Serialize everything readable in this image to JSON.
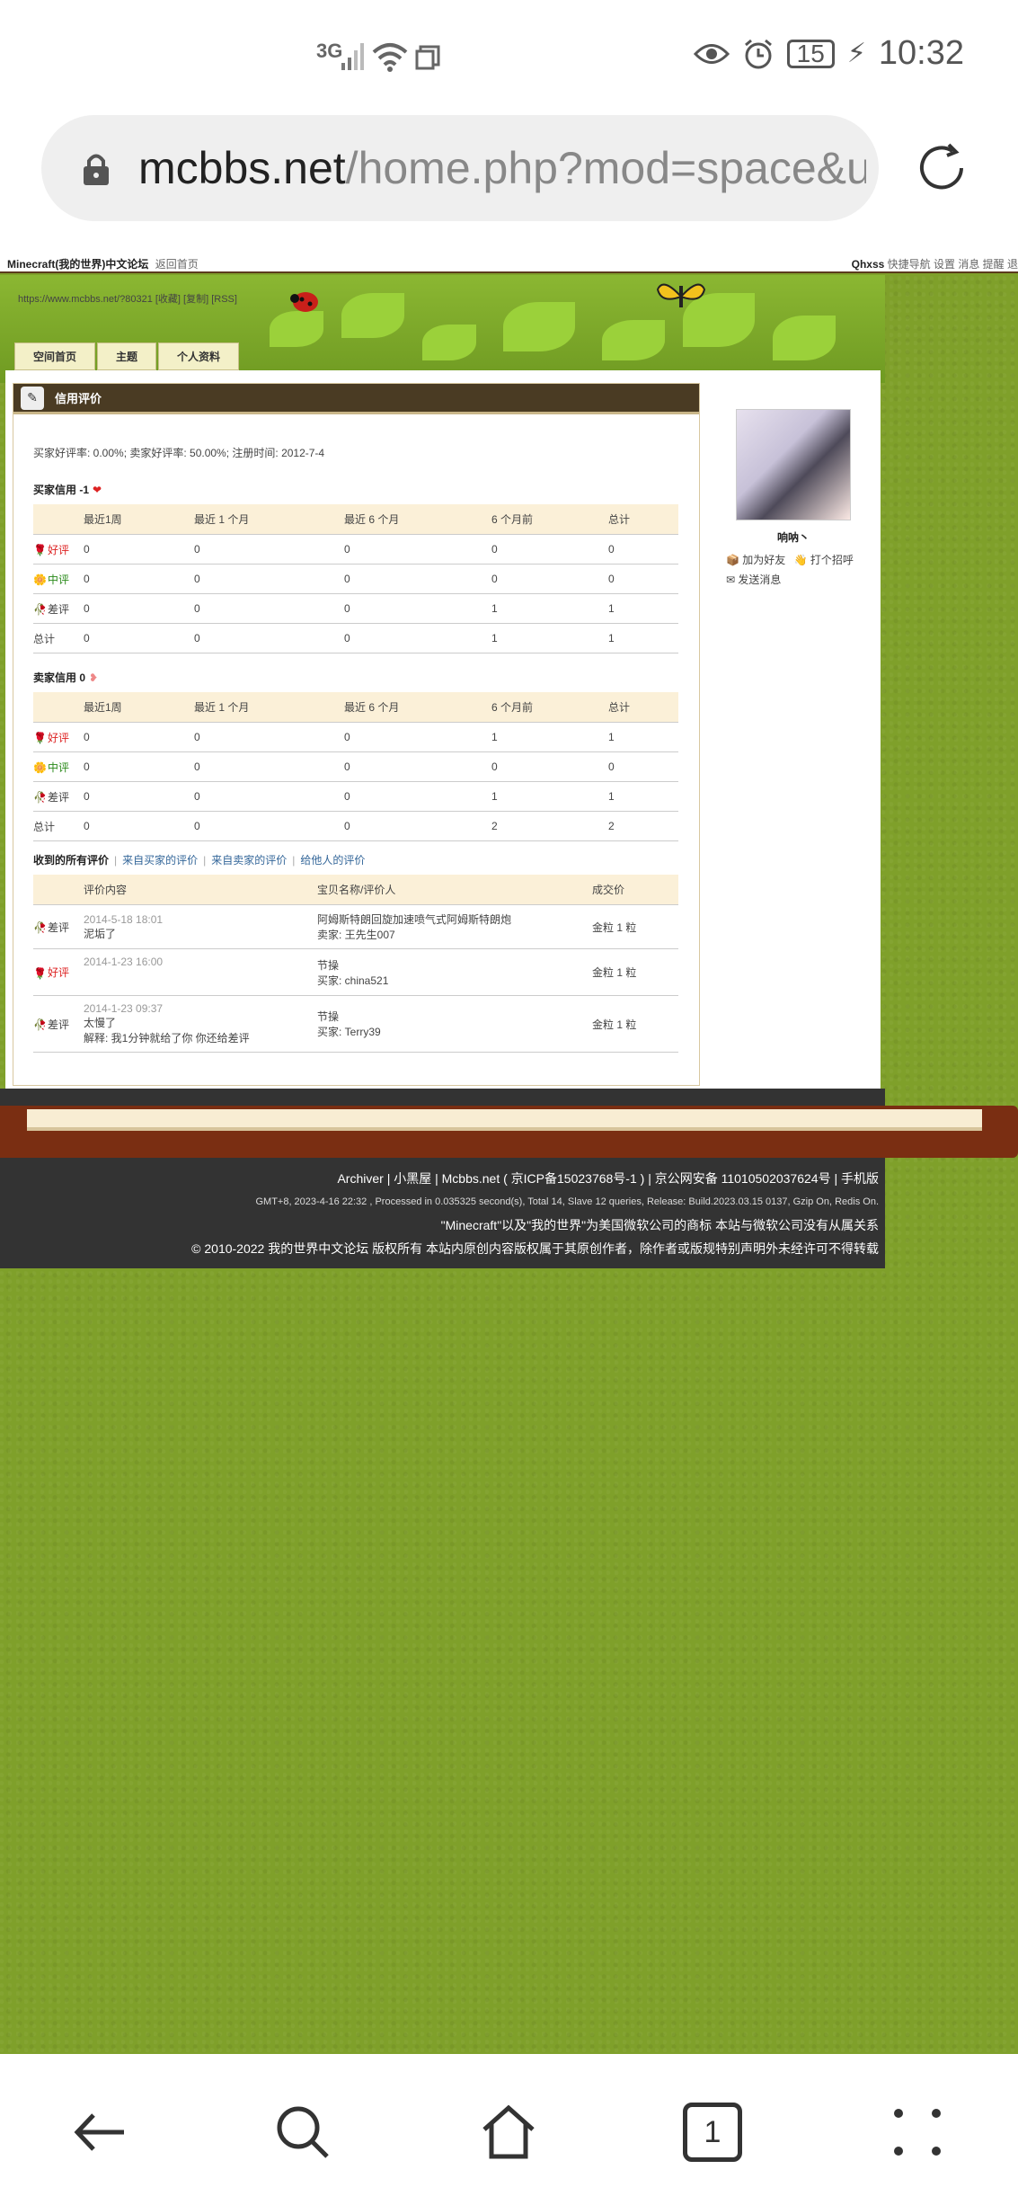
{
  "status": {
    "network": "3G",
    "battery": "15",
    "time": "10:32"
  },
  "browser": {
    "url_host": "mcbbs.net",
    "url_path": "/home.php?mod=space&ui",
    "tab_count": "1"
  },
  "topbar": {
    "brand": "Minecraft(我的世界)中文论坛",
    "back": "返回首页",
    "username": "Qhxss",
    "right_links": "快捷导航 设置 消息 提醒 退"
  },
  "space_url": "https://www.mcbbs.net/?80321 [收藏] [复制] [RSS]",
  "tabs": [
    "空间首页",
    "主题",
    "个人资料"
  ],
  "section_title": "信用评价",
  "rates": "买家好评率: 0.00%;  卖家好评率: 50.00%;  注册时间: 2012-7-4",
  "buyer": {
    "title": "买家信用 -1",
    "headers": [
      "",
      "最近1周",
      "最近 1 个月",
      "最近 6 个月",
      "6 个月前",
      "总计"
    ],
    "rows": [
      [
        "好评",
        "0",
        "0",
        "0",
        "0",
        "0"
      ],
      [
        "中评",
        "0",
        "0",
        "0",
        "0",
        "0"
      ],
      [
        "差评",
        "0",
        "0",
        "0",
        "1",
        "1"
      ],
      [
        "总计",
        "0",
        "0",
        "0",
        "1",
        "1"
      ]
    ]
  },
  "seller": {
    "title": "卖家信用 0",
    "headers": [
      "",
      "最近1周",
      "最近 1 个月",
      "最近 6 个月",
      "6 个月前",
      "总计"
    ],
    "rows": [
      [
        "好评",
        "0",
        "0",
        "0",
        "1",
        "1"
      ],
      [
        "中评",
        "0",
        "0",
        "0",
        "0",
        "0"
      ],
      [
        "差评",
        "0",
        "0",
        "0",
        "1",
        "1"
      ],
      [
        "总计",
        "0",
        "0",
        "0",
        "2",
        "2"
      ]
    ]
  },
  "filters": {
    "all": "收到的所有评价",
    "from_buyer": "来自买家的评价",
    "from_seller": "来自卖家的评价",
    "to_others": "给他人的评价"
  },
  "reviews": {
    "headers": [
      "",
      "评价内容",
      "宝贝名称/评价人",
      "成交价"
    ],
    "items": [
      {
        "type": "差评",
        "time": "2014-5-18 18:01",
        "content": "泥垢了",
        "content2": "",
        "item": "阿姆斯特朗回旋加速喷气式阿姆斯特朗炮",
        "person": "卖家: 王先生007",
        "price": "金粒 1 粒"
      },
      {
        "type": "好评",
        "time": "2014-1-23 16:00",
        "content": "",
        "content2": "",
        "item": "节操",
        "person": "买家: china521",
        "price": "金粒 1 粒"
      },
      {
        "type": "差评",
        "time": "2014-1-23 09:37",
        "content": "太慢了",
        "content2": "解释: 我1分钟就给了你 你还给差评",
        "item": "节操",
        "person": "买家: Terry39",
        "price": "金粒 1 粒"
      }
    ]
  },
  "sidebar": {
    "username": "响呐丶",
    "add_friend": "加为好友",
    "greet": "打个招呼",
    "message": "发送消息"
  },
  "footer": {
    "links": "Archiver | 小黑屋 | Mcbbs.net ( 京ICP备15023768号-1 ) | 京公网安备 11010502037624号 | 手机版",
    "stats": "GMT+8, 2023-4-16 22:32 , Processed in 0.035325 second(s), Total 14, Slave 12 queries, Release: Build.2023.03.15 0137, Gzip On, Redis On.",
    "trademark": "\"Minecraft\"以及\"我的世界\"为美国微软公司的商标 本站与微软公司没有从属关系",
    "copyright": "© 2010-2022 我的世界中文论坛 版权所有 本站内原创内容版权属于其原创作者，除作者或版规特别声明外未经许可不得转载"
  }
}
